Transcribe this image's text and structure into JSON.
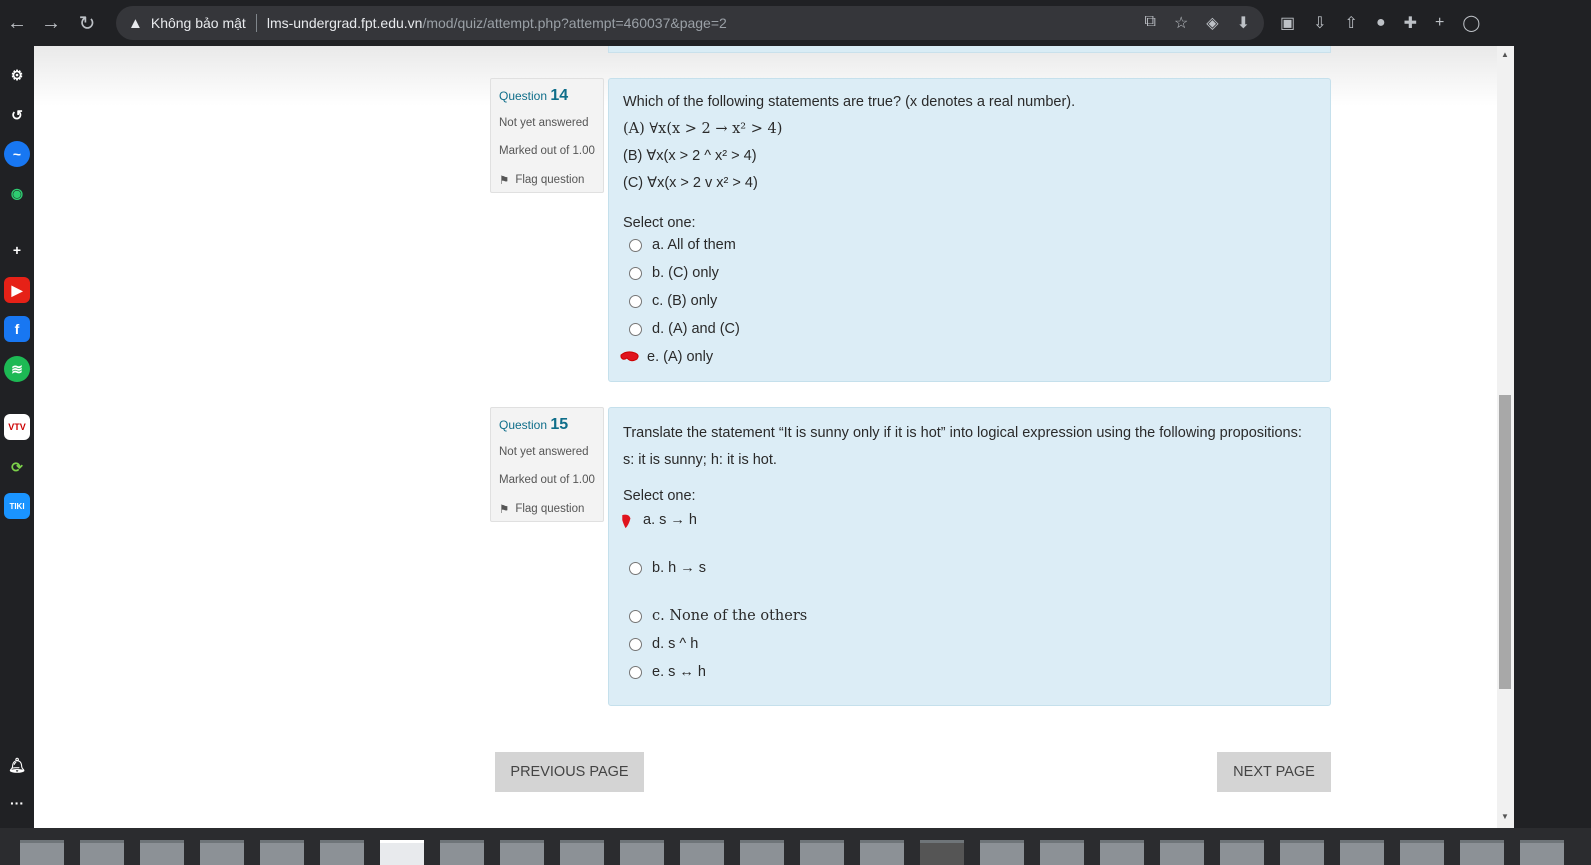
{
  "browser": {
    "security_label": "Không bảo mật",
    "url_host": "lms-undergrad.fpt.edu.vn",
    "url_path": "/mod/quiz/attempt.php?attempt=460037&page=2"
  },
  "questions": [
    {
      "label": "Question",
      "number": "14",
      "state": "Not yet answered",
      "marks": "Marked out of 1.00",
      "flag": "Flag question",
      "text": "Which of the following statements are true? (x denotes a real number).",
      "statements": [
        "(A) ∀x(x > 2 → x² > 4)",
        "(B) ∀x(x > 2 ^ x² > 4)",
        "(C)  ∀x(x > 2 v x² > 4)"
      ],
      "select_label": "Select one:",
      "answers": [
        "a. All of them",
        "b. (C) only",
        "c. (B) only",
        "d. (A) and (C)",
        "e. (A) only"
      ]
    },
    {
      "label": "Question",
      "number": "15",
      "state": "Not yet answered",
      "marks": "Marked out of 1.00",
      "flag": "Flag question",
      "text": "Translate the statement “It is sunny only if it is hot” into logical expression using the following propositions:",
      "subtext": "s: it is sunny; h: it is hot.",
      "select_label": "Select one:",
      "answers": [
        "a. s → h",
        "b. h → s",
        "c. None of the others",
        "d. s ^ h",
        "e. s ↔ h"
      ]
    }
  ],
  "buttons": {
    "previous": "PREVIOUS PAGE",
    "next": "NEXT PAGE"
  }
}
